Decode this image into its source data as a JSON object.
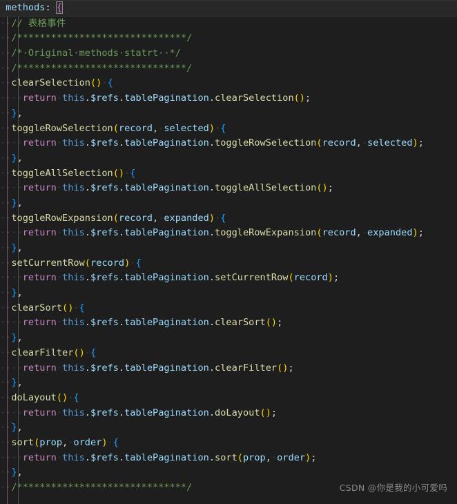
{
  "editor": {
    "background": "#1e1e1e",
    "current_line_background": "#282828",
    "font_size": "13.6px",
    "line_height": "21.7px",
    "theme_name": "Dark+",
    "language": "javascript"
  },
  "colors": {
    "comment": "#6a9955",
    "keyword": "#c586c0",
    "this": "#569cd6",
    "property": "#9cdcfe",
    "function": "#dcdcaa",
    "plain": "#d4d4d4",
    "paren_level1": "#ffd700",
    "paren_level2": "#da70d6",
    "paren_level3": "#179fff",
    "indent_guide_active": "#c586c0",
    "indent_guide": "#515151",
    "watermark": "#8a8a8a"
  },
  "watermark": {
    "text": "CSDN @你是我的小可爱吗"
  },
  "lines": [
    {
      "n": 1,
      "current": true,
      "tokens": [
        {
          "c": "t-ws",
          "s": "·"
        },
        {
          "c": "t-prop",
          "s": "methods"
        },
        {
          "c": "t-punct",
          "s": ":"
        },
        {
          "c": "t-ws",
          "s": "·"
        },
        {
          "c": "t-brace-p bracket-match",
          "s": "{"
        }
      ]
    },
    {
      "n": 2,
      "current": false,
      "tokens": [
        {
          "c": "t-ws",
          "s": "··"
        },
        {
          "c": "t-comment",
          "s": "// 表格事件"
        }
      ]
    },
    {
      "n": 3,
      "current": false,
      "tokens": [
        {
          "c": "t-ws",
          "s": "··"
        },
        {
          "c": "t-comment",
          "s": "/******************************/"
        }
      ]
    },
    {
      "n": 4,
      "current": false,
      "tokens": [
        {
          "c": "t-ws",
          "s": "··"
        },
        {
          "c": "t-comment",
          "s": "/*·Original·methods·statrt··*/"
        }
      ]
    },
    {
      "n": 5,
      "current": false,
      "tokens": [
        {
          "c": "t-ws",
          "s": "··"
        },
        {
          "c": "t-comment",
          "s": "/******************************/"
        }
      ]
    },
    {
      "n": 6,
      "current": false,
      "tokens": [
        {
          "c": "t-ws",
          "s": "··"
        },
        {
          "c": "t-func",
          "s": "clearSelection"
        },
        {
          "c": "t-paren1",
          "s": "()"
        },
        {
          "c": "t-ws",
          "s": "·"
        },
        {
          "c": "t-brace-b",
          "s": "{"
        }
      ]
    },
    {
      "n": 7,
      "current": false,
      "tokens": [
        {
          "c": "t-ws",
          "s": "····"
        },
        {
          "c": "t-keyword",
          "s": "return"
        },
        {
          "c": "t-ws",
          "s": "·"
        },
        {
          "c": "t-this",
          "s": "this"
        },
        {
          "c": "t-punct",
          "s": "."
        },
        {
          "c": "t-prop",
          "s": "$refs"
        },
        {
          "c": "t-punct",
          "s": "."
        },
        {
          "c": "t-prop",
          "s": "tablePagination"
        },
        {
          "c": "t-punct",
          "s": "."
        },
        {
          "c": "t-func",
          "s": "clearSelection"
        },
        {
          "c": "t-paren1",
          "s": "()"
        },
        {
          "c": "t-punct",
          "s": ";"
        }
      ]
    },
    {
      "n": 8,
      "current": false,
      "tokens": [
        {
          "c": "t-ws",
          "s": "··"
        },
        {
          "c": "t-brace-b",
          "s": "}"
        },
        {
          "c": "t-punct",
          "s": ","
        }
      ]
    },
    {
      "n": 9,
      "current": false,
      "tokens": [
        {
          "c": "t-ws",
          "s": "··"
        },
        {
          "c": "t-func",
          "s": "toggleRowSelection"
        },
        {
          "c": "t-paren1",
          "s": "("
        },
        {
          "c": "t-param",
          "s": "record"
        },
        {
          "c": "t-punct",
          "s": ","
        },
        {
          "c": "t-ws",
          "s": "·"
        },
        {
          "c": "t-param",
          "s": "selected"
        },
        {
          "c": "t-paren1",
          "s": ")"
        },
        {
          "c": "t-ws",
          "s": "·"
        },
        {
          "c": "t-brace-b",
          "s": "{"
        }
      ]
    },
    {
      "n": 10,
      "current": false,
      "tokens": [
        {
          "c": "t-ws",
          "s": "····"
        },
        {
          "c": "t-keyword",
          "s": "return"
        },
        {
          "c": "t-ws",
          "s": "·"
        },
        {
          "c": "t-this",
          "s": "this"
        },
        {
          "c": "t-punct",
          "s": "."
        },
        {
          "c": "t-prop",
          "s": "$refs"
        },
        {
          "c": "t-punct",
          "s": "."
        },
        {
          "c": "t-prop",
          "s": "tablePagination"
        },
        {
          "c": "t-punct",
          "s": "."
        },
        {
          "c": "t-func",
          "s": "toggleRowSelection"
        },
        {
          "c": "t-paren1",
          "s": "("
        },
        {
          "c": "t-param",
          "s": "record"
        },
        {
          "c": "t-punct",
          "s": ","
        },
        {
          "c": "t-ws",
          "s": "·"
        },
        {
          "c": "t-param",
          "s": "selected"
        },
        {
          "c": "t-paren1",
          "s": ")"
        },
        {
          "c": "t-punct",
          "s": ";"
        }
      ]
    },
    {
      "n": 11,
      "current": false,
      "tokens": [
        {
          "c": "t-ws",
          "s": "··"
        },
        {
          "c": "t-brace-b",
          "s": "}"
        },
        {
          "c": "t-punct",
          "s": ","
        }
      ]
    },
    {
      "n": 12,
      "current": false,
      "tokens": [
        {
          "c": "t-ws",
          "s": "··"
        },
        {
          "c": "t-func",
          "s": "toggleAllSelection"
        },
        {
          "c": "t-paren1",
          "s": "()"
        },
        {
          "c": "t-ws",
          "s": "·"
        },
        {
          "c": "t-brace-b",
          "s": "{"
        }
      ]
    },
    {
      "n": 13,
      "current": false,
      "tokens": [
        {
          "c": "t-ws",
          "s": "····"
        },
        {
          "c": "t-keyword",
          "s": "return"
        },
        {
          "c": "t-ws",
          "s": "·"
        },
        {
          "c": "t-this",
          "s": "this"
        },
        {
          "c": "t-punct",
          "s": "."
        },
        {
          "c": "t-prop",
          "s": "$refs"
        },
        {
          "c": "t-punct",
          "s": "."
        },
        {
          "c": "t-prop",
          "s": "tablePagination"
        },
        {
          "c": "t-punct",
          "s": "."
        },
        {
          "c": "t-func",
          "s": "toggleAllSelection"
        },
        {
          "c": "t-paren1",
          "s": "()"
        },
        {
          "c": "t-punct",
          "s": ";"
        }
      ]
    },
    {
      "n": 14,
      "current": false,
      "tokens": [
        {
          "c": "t-ws",
          "s": "··"
        },
        {
          "c": "t-brace-b",
          "s": "}"
        },
        {
          "c": "t-punct",
          "s": ","
        }
      ]
    },
    {
      "n": 15,
      "current": false,
      "tokens": [
        {
          "c": "t-ws",
          "s": "··"
        },
        {
          "c": "t-func",
          "s": "toggleRowExpansion"
        },
        {
          "c": "t-paren1",
          "s": "("
        },
        {
          "c": "t-param",
          "s": "record"
        },
        {
          "c": "t-punct",
          "s": ","
        },
        {
          "c": "t-ws",
          "s": "·"
        },
        {
          "c": "t-param",
          "s": "expanded"
        },
        {
          "c": "t-paren1",
          "s": ")"
        },
        {
          "c": "t-ws",
          "s": "·"
        },
        {
          "c": "t-brace-b",
          "s": "{"
        }
      ]
    },
    {
      "n": 16,
      "current": false,
      "tokens": [
        {
          "c": "t-ws",
          "s": "····"
        },
        {
          "c": "t-keyword",
          "s": "return"
        },
        {
          "c": "t-ws",
          "s": "·"
        },
        {
          "c": "t-this",
          "s": "this"
        },
        {
          "c": "t-punct",
          "s": "."
        },
        {
          "c": "t-prop",
          "s": "$refs"
        },
        {
          "c": "t-punct",
          "s": "."
        },
        {
          "c": "t-prop",
          "s": "tablePagination"
        },
        {
          "c": "t-punct",
          "s": "."
        },
        {
          "c": "t-func",
          "s": "toggleRowExpansion"
        },
        {
          "c": "t-paren1",
          "s": "("
        },
        {
          "c": "t-param",
          "s": "record"
        },
        {
          "c": "t-punct",
          "s": ","
        },
        {
          "c": "t-ws",
          "s": "·"
        },
        {
          "c": "t-param",
          "s": "expanded"
        },
        {
          "c": "t-paren1",
          "s": ")"
        },
        {
          "c": "t-punct",
          "s": ";"
        }
      ]
    },
    {
      "n": 17,
      "current": false,
      "tokens": [
        {
          "c": "t-ws",
          "s": "··"
        },
        {
          "c": "t-brace-b",
          "s": "}"
        },
        {
          "c": "t-punct",
          "s": ","
        }
      ]
    },
    {
      "n": 18,
      "current": false,
      "tokens": [
        {
          "c": "t-ws",
          "s": "··"
        },
        {
          "c": "t-func",
          "s": "setCurrentRow"
        },
        {
          "c": "t-paren1",
          "s": "("
        },
        {
          "c": "t-param",
          "s": "record"
        },
        {
          "c": "t-paren1",
          "s": ")"
        },
        {
          "c": "t-ws",
          "s": "·"
        },
        {
          "c": "t-brace-b",
          "s": "{"
        }
      ]
    },
    {
      "n": 19,
      "current": false,
      "tokens": [
        {
          "c": "t-ws",
          "s": "····"
        },
        {
          "c": "t-keyword",
          "s": "return"
        },
        {
          "c": "t-ws",
          "s": "·"
        },
        {
          "c": "t-this",
          "s": "this"
        },
        {
          "c": "t-punct",
          "s": "."
        },
        {
          "c": "t-prop",
          "s": "$refs"
        },
        {
          "c": "t-punct",
          "s": "."
        },
        {
          "c": "t-prop",
          "s": "tablePagination"
        },
        {
          "c": "t-punct",
          "s": "."
        },
        {
          "c": "t-func",
          "s": "setCurrentRow"
        },
        {
          "c": "t-paren1",
          "s": "("
        },
        {
          "c": "t-param",
          "s": "record"
        },
        {
          "c": "t-paren1",
          "s": ")"
        },
        {
          "c": "t-punct",
          "s": ";"
        }
      ]
    },
    {
      "n": 20,
      "current": false,
      "tokens": [
        {
          "c": "t-ws",
          "s": "··"
        },
        {
          "c": "t-brace-b",
          "s": "}"
        },
        {
          "c": "t-punct",
          "s": ","
        }
      ]
    },
    {
      "n": 21,
      "current": false,
      "tokens": [
        {
          "c": "t-ws",
          "s": "··"
        },
        {
          "c": "t-func",
          "s": "clearSort"
        },
        {
          "c": "t-paren1",
          "s": "()"
        },
        {
          "c": "t-ws",
          "s": "·"
        },
        {
          "c": "t-brace-b",
          "s": "{"
        }
      ]
    },
    {
      "n": 22,
      "current": false,
      "tokens": [
        {
          "c": "t-ws",
          "s": "····"
        },
        {
          "c": "t-keyword",
          "s": "return"
        },
        {
          "c": "t-ws",
          "s": "·"
        },
        {
          "c": "t-this",
          "s": "this"
        },
        {
          "c": "t-punct",
          "s": "."
        },
        {
          "c": "t-prop",
          "s": "$refs"
        },
        {
          "c": "t-punct",
          "s": "."
        },
        {
          "c": "t-prop",
          "s": "tablePagination"
        },
        {
          "c": "t-punct",
          "s": "."
        },
        {
          "c": "t-func",
          "s": "clearSort"
        },
        {
          "c": "t-paren1",
          "s": "()"
        },
        {
          "c": "t-punct",
          "s": ";"
        }
      ]
    },
    {
      "n": 23,
      "current": false,
      "tokens": [
        {
          "c": "t-ws",
          "s": "··"
        },
        {
          "c": "t-brace-b",
          "s": "}"
        },
        {
          "c": "t-punct",
          "s": ","
        }
      ]
    },
    {
      "n": 24,
      "current": false,
      "tokens": [
        {
          "c": "t-ws",
          "s": "··"
        },
        {
          "c": "t-func",
          "s": "clearFilter"
        },
        {
          "c": "t-paren1",
          "s": "()"
        },
        {
          "c": "t-ws",
          "s": "·"
        },
        {
          "c": "t-brace-b",
          "s": "{"
        }
      ]
    },
    {
      "n": 25,
      "current": false,
      "tokens": [
        {
          "c": "t-ws",
          "s": "····"
        },
        {
          "c": "t-keyword",
          "s": "return"
        },
        {
          "c": "t-ws",
          "s": "·"
        },
        {
          "c": "t-this",
          "s": "this"
        },
        {
          "c": "t-punct",
          "s": "."
        },
        {
          "c": "t-prop",
          "s": "$refs"
        },
        {
          "c": "t-punct",
          "s": "."
        },
        {
          "c": "t-prop",
          "s": "tablePagination"
        },
        {
          "c": "t-punct",
          "s": "."
        },
        {
          "c": "t-func",
          "s": "clearFilter"
        },
        {
          "c": "t-paren1",
          "s": "()"
        },
        {
          "c": "t-punct",
          "s": ";"
        }
      ]
    },
    {
      "n": 26,
      "current": false,
      "tokens": [
        {
          "c": "t-ws",
          "s": "··"
        },
        {
          "c": "t-brace-b",
          "s": "}"
        },
        {
          "c": "t-punct",
          "s": ","
        }
      ]
    },
    {
      "n": 27,
      "current": false,
      "tokens": [
        {
          "c": "t-ws",
          "s": "··"
        },
        {
          "c": "t-func",
          "s": "doLayout"
        },
        {
          "c": "t-paren1",
          "s": "()"
        },
        {
          "c": "t-ws",
          "s": "·"
        },
        {
          "c": "t-brace-b",
          "s": "{"
        }
      ]
    },
    {
      "n": 28,
      "current": false,
      "tokens": [
        {
          "c": "t-ws",
          "s": "····"
        },
        {
          "c": "t-keyword",
          "s": "return"
        },
        {
          "c": "t-ws",
          "s": "·"
        },
        {
          "c": "t-this",
          "s": "this"
        },
        {
          "c": "t-punct",
          "s": "."
        },
        {
          "c": "t-prop",
          "s": "$refs"
        },
        {
          "c": "t-punct",
          "s": "."
        },
        {
          "c": "t-prop",
          "s": "tablePagination"
        },
        {
          "c": "t-punct",
          "s": "."
        },
        {
          "c": "t-func",
          "s": "doLayout"
        },
        {
          "c": "t-paren1",
          "s": "()"
        },
        {
          "c": "t-punct",
          "s": ";"
        }
      ]
    },
    {
      "n": 29,
      "current": false,
      "tokens": [
        {
          "c": "t-ws",
          "s": "··"
        },
        {
          "c": "t-brace-b",
          "s": "}"
        },
        {
          "c": "t-punct",
          "s": ","
        }
      ]
    },
    {
      "n": 30,
      "current": false,
      "tokens": [
        {
          "c": "t-ws",
          "s": "··"
        },
        {
          "c": "t-func",
          "s": "sort"
        },
        {
          "c": "t-paren1",
          "s": "("
        },
        {
          "c": "t-param",
          "s": "prop"
        },
        {
          "c": "t-punct",
          "s": ","
        },
        {
          "c": "t-ws",
          "s": "·"
        },
        {
          "c": "t-param",
          "s": "order"
        },
        {
          "c": "t-paren1",
          "s": ")"
        },
        {
          "c": "t-ws",
          "s": "·"
        },
        {
          "c": "t-brace-b",
          "s": "{"
        }
      ]
    },
    {
      "n": 31,
      "current": false,
      "tokens": [
        {
          "c": "t-ws",
          "s": "····"
        },
        {
          "c": "t-keyword",
          "s": "return"
        },
        {
          "c": "t-ws",
          "s": "·"
        },
        {
          "c": "t-this",
          "s": "this"
        },
        {
          "c": "t-punct",
          "s": "."
        },
        {
          "c": "t-prop",
          "s": "$refs"
        },
        {
          "c": "t-punct",
          "s": "."
        },
        {
          "c": "t-prop",
          "s": "tablePagination"
        },
        {
          "c": "t-punct",
          "s": "."
        },
        {
          "c": "t-func",
          "s": "sort"
        },
        {
          "c": "t-paren1",
          "s": "("
        },
        {
          "c": "t-param",
          "s": "prop"
        },
        {
          "c": "t-punct",
          "s": ","
        },
        {
          "c": "t-ws",
          "s": "·"
        },
        {
          "c": "t-param",
          "s": "order"
        },
        {
          "c": "t-paren1",
          "s": ")"
        },
        {
          "c": "t-punct",
          "s": ";"
        }
      ]
    },
    {
      "n": 32,
      "current": false,
      "tokens": [
        {
          "c": "t-ws",
          "s": "··"
        },
        {
          "c": "t-brace-b",
          "s": "}"
        },
        {
          "c": "t-punct",
          "s": ","
        }
      ]
    },
    {
      "n": 33,
      "current": false,
      "tokens": [
        {
          "c": "t-ws",
          "s": "··"
        },
        {
          "c": "t-comment",
          "s": "/******************************/"
        }
      ]
    }
  ]
}
